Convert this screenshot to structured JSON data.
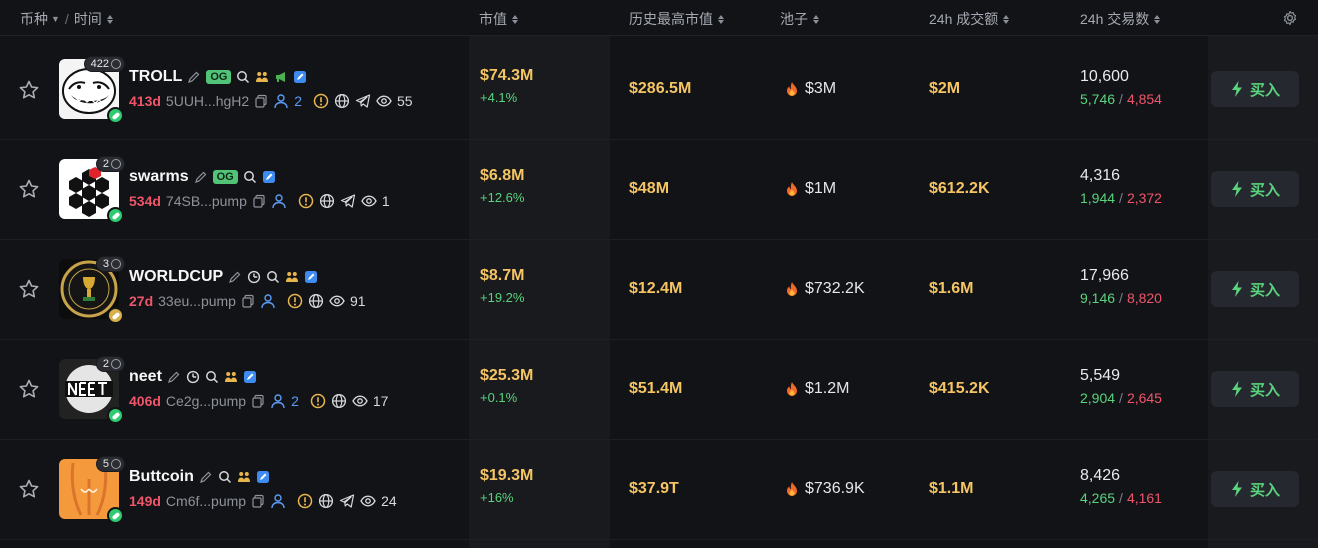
{
  "header": {
    "token": "币种",
    "time": "时间",
    "market_cap": "市值",
    "ath_market_cap": "历史最高市值",
    "pool": "池子",
    "volume_24h": "24h 成交额",
    "txns_24h": "24h 交易数",
    "separator": "/"
  },
  "colors": {
    "accent_green": "#5ad37d",
    "accent_red": "#f0556b",
    "gold": "#f5c563",
    "og_badge": "#52c477"
  },
  "rows": [
    {
      "name": "TROLL",
      "holders": "422",
      "og": "OG",
      "age": "413d",
      "address": "5UUH...hgH2",
      "people_count": "2",
      "view_count": "55",
      "market_cap": "$74.3M",
      "change": "+4.1%",
      "ath": "$286.5M",
      "pool": "$3M",
      "volume": "$2M",
      "txns": "10,600",
      "buys": "5,746",
      "sells": "4,854",
      "buy_label": "买入"
    },
    {
      "name": "swarms",
      "holders": "2",
      "og": "OG",
      "age": "534d",
      "address": "74SB...pump",
      "people_count": "",
      "view_count": "1",
      "market_cap": "$6.8M",
      "change": "+12.6%",
      "ath": "$48M",
      "pool": "$1M",
      "volume": "$612.2K",
      "txns": "4,316",
      "buys": "1,944",
      "sells": "2,372",
      "buy_label": "买入"
    },
    {
      "name": "WORLDCUP",
      "holders": "3",
      "og": "",
      "age": "27d",
      "address": "33eu...pump",
      "people_count": "",
      "view_count": "91",
      "market_cap": "$8.7M",
      "change": "+19.2%",
      "ath": "$12.4M",
      "pool": "$732.2K",
      "volume": "$1.6M",
      "txns": "17,966",
      "buys": "9,146",
      "sells": "8,820",
      "buy_label": "买入"
    },
    {
      "name": "neet",
      "holders": "2",
      "og": "",
      "age": "406d",
      "address": "Ce2g...pump",
      "people_count": "2",
      "view_count": "17",
      "market_cap": "$25.3M",
      "change": "+0.1%",
      "ath": "$51.4M",
      "pool": "$1.2M",
      "volume": "$415.2K",
      "txns": "5,549",
      "buys": "2,904",
      "sells": "2,645",
      "buy_label": "买入"
    },
    {
      "name": "Buttcoin",
      "holders": "5",
      "og": "",
      "age": "149d",
      "address": "Cm6f...pump",
      "people_count": "",
      "view_count": "24",
      "market_cap": "$19.3M",
      "change": "+16%",
      "ath": "$37.9T",
      "pool": "$736.9K",
      "volume": "$1.1M",
      "txns": "8,426",
      "buys": "4,265",
      "sells": "4,161",
      "buy_label": "买入"
    }
  ]
}
